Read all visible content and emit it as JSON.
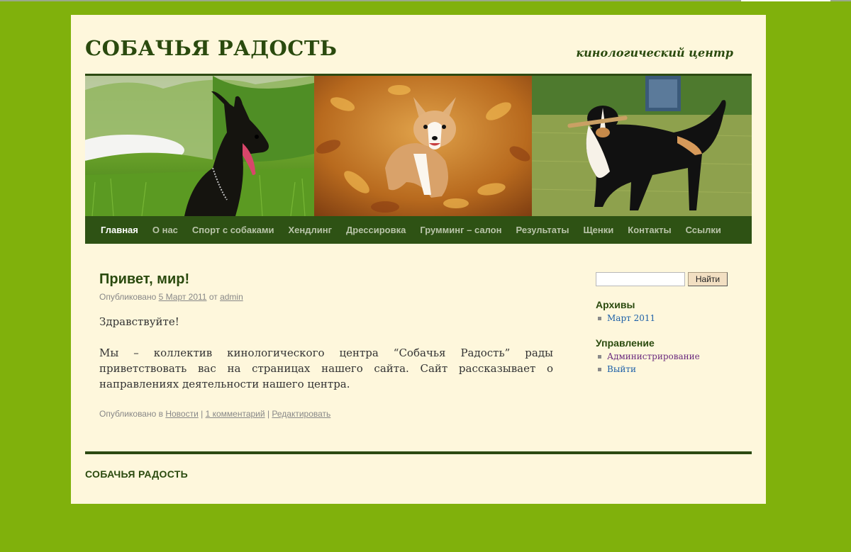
{
  "colors": {
    "page_background": "#80b10c",
    "wrapper_background": "#fef7dc",
    "accent_dark_green": "#2e5214",
    "title_green": "#2a4a0e",
    "link_blue": "#1c5fa8",
    "link_visited": "#6a2a7e"
  },
  "header": {
    "site_title": "СОБАЧЬЯ РАДОСТЬ",
    "site_description": "кинологический центр"
  },
  "banner": {
    "panels": [
      "black-shepherd-dog-image",
      "corgi-autumn-leaves-image",
      "collie-with-stick-image"
    ]
  },
  "nav": {
    "items": [
      {
        "label": "Главная",
        "current": true
      },
      {
        "label": "О нас"
      },
      {
        "label": "Спорт с собаками"
      },
      {
        "label": "Хендлинг"
      },
      {
        "label": "Дрессировка"
      },
      {
        "label": "Грумминг – салон"
      },
      {
        "label": "Результаты"
      },
      {
        "label": "Щенки"
      },
      {
        "label": "Контакты"
      },
      {
        "label": "Ссылки"
      }
    ]
  },
  "post": {
    "title": "Привет, мир!",
    "meta_prefix": "Опубликовано",
    "date": "5 Март 2011",
    "by": "от",
    "author": "admin",
    "paragraph1": "Здравствуйте!",
    "paragraph2": "Мы – коллектив кинологического центра “Собачья Радость” рады приветствовать вас на страницах нашего сайта. Сайт рассказывает о направлениях деятельности нашего центра.",
    "utility_prefix": "Опубликовано в",
    "category": "Новости",
    "sep1": "|",
    "comments": "1 комментарий",
    "sep2": "|",
    "edit": "Редактировать"
  },
  "sidebar": {
    "search_value": "",
    "search_button": "Найти",
    "archives_title": "Архивы",
    "archives": [
      "Март 2011"
    ],
    "manage_title": "Управление",
    "manage_items": [
      "Администрирование",
      "Выйти"
    ]
  },
  "footer": {
    "site_title": "СОБАЧЬЯ РАДОСТЬ"
  }
}
